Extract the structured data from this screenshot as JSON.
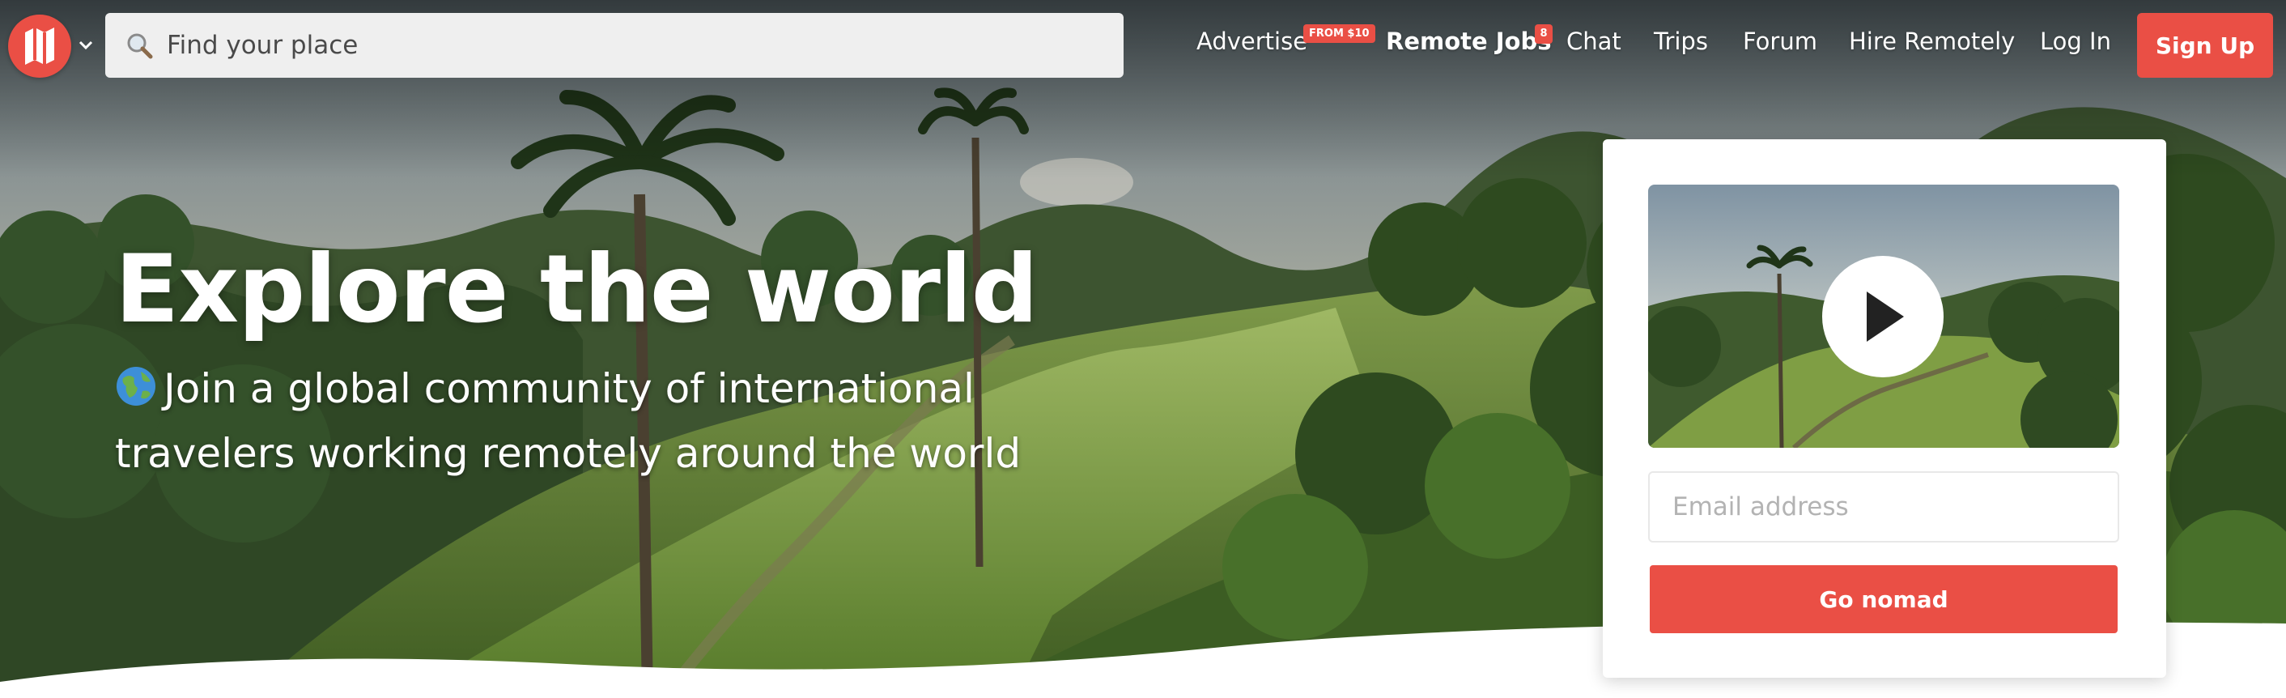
{
  "brand": {
    "logo_icon": "nomad-map-icon",
    "accent_color": "#ea4f45"
  },
  "search": {
    "placeholder": "Find your place",
    "icon": "magnifier-icon"
  },
  "nav": {
    "advertise": {
      "label": "Advertise",
      "badge": "FROM $10"
    },
    "remote_jobs": {
      "label": "Remote Jobs",
      "badge": "8"
    },
    "chat": "Chat",
    "trips": "Trips",
    "forum": "Forum",
    "hire_remotely": "Hire Remotely",
    "log_in": "Log In",
    "sign_up": "Sign Up"
  },
  "hero": {
    "title": "Explore the world",
    "subtitle_emoji": "globe-icon",
    "subtitle": "Join a global community of international travelers working remotely around the world"
  },
  "signup_card": {
    "video_icon": "play-icon",
    "email_placeholder": "Email address",
    "button_label": "Go nomad"
  }
}
